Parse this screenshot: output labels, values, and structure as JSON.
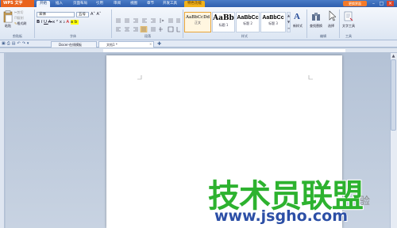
{
  "titlebar": {
    "app_name": "WPS 文字",
    "tabs": [
      "开始",
      "插入",
      "页面布局",
      "引用",
      "审阅",
      "视图",
      "章节",
      "开发工具",
      "特色功能"
    ],
    "active_tab": "开始",
    "skin_label": "更换界面",
    "window_controls": [
      "–",
      "□",
      "×"
    ]
  },
  "ribbon": {
    "clipboard": {
      "paste": "粘贴",
      "cut": "剪切",
      "copy": "复制",
      "format_painter": "格式刷",
      "group_label": "剪贴板"
    },
    "font": {
      "font_name": "宋体",
      "font_size": "五号",
      "group_label": "字体"
    },
    "paragraph": {
      "group_label": "段落"
    },
    "styles": {
      "items": [
        {
          "sample": "AaBbCcDd",
          "name": "正文"
        },
        {
          "sample": "AaBb",
          "name": "标题 1"
        },
        {
          "sample": "AaBbCc",
          "name": "标题 2"
        },
        {
          "sample": "AaBbCc",
          "name": "标题 3"
        }
      ],
      "new_style": "新样式",
      "group_label": "样式"
    },
    "editing": {
      "find_replace": "查找替换",
      "select": "选择",
      "group_label": "编辑"
    },
    "tools": {
      "text_tools": "文字工具",
      "group_label": "工具"
    }
  },
  "doc_tabs": [
    {
      "label": "Docer-在线模板",
      "active": false
    },
    {
      "label": "文档1 *",
      "active": true
    }
  ],
  "watermark": {
    "main": "技术员联盟",
    "url": "www.jsgho.com",
    "side": "验"
  }
}
